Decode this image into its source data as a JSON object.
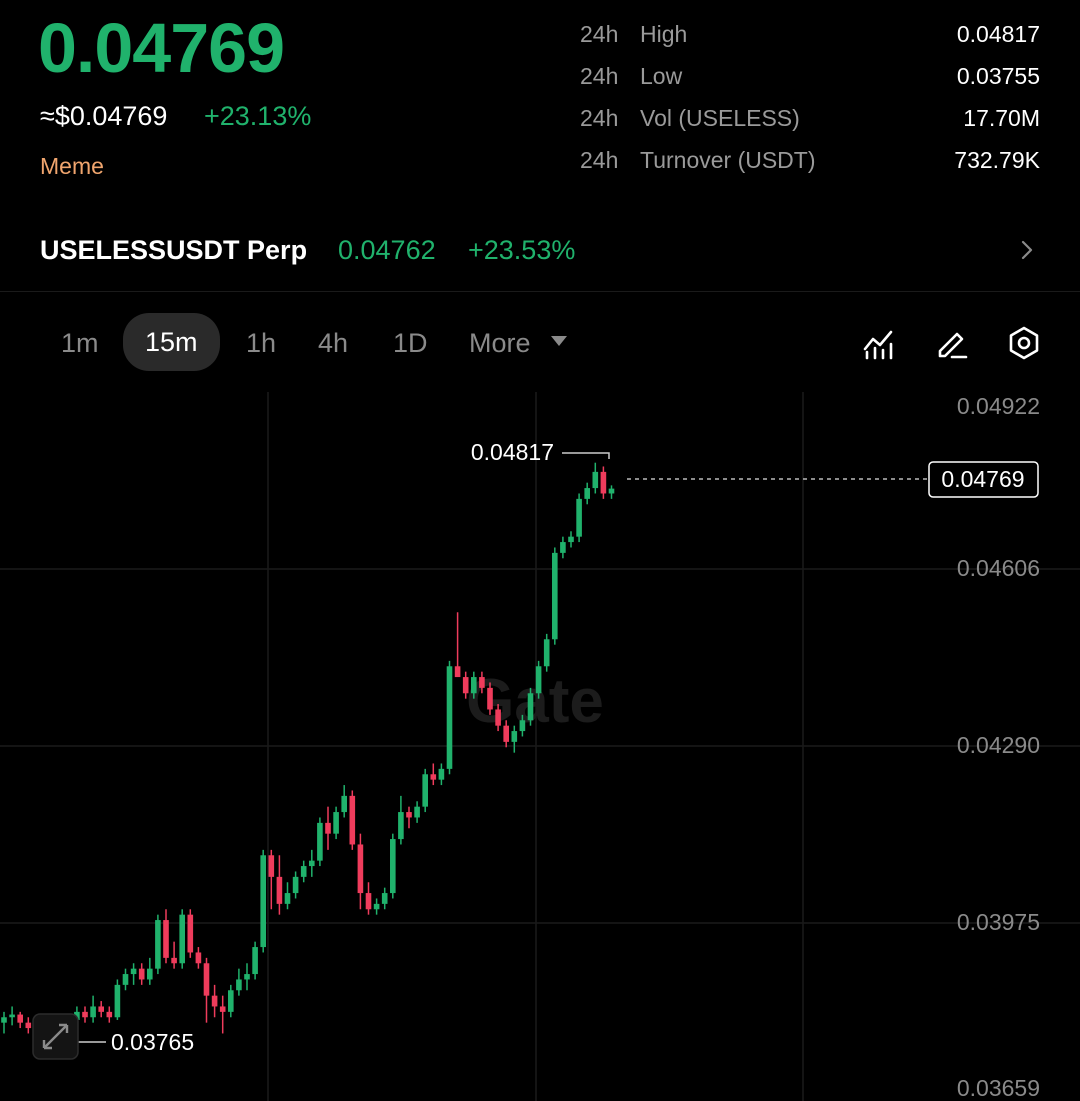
{
  "header": {
    "last_price": "0.04769",
    "usd_price": "≈$0.04769",
    "change_pct": "+23.13%",
    "tag": "Meme"
  },
  "stats": [
    {
      "period": "24h",
      "label": "High",
      "value": "0.04817"
    },
    {
      "period": "24h",
      "label": "Low",
      "value": "0.03755"
    },
    {
      "period": "24h",
      "label": "Vol (USELESS)",
      "value": "17.70M"
    },
    {
      "period": "24h",
      "label": "Turnover (USDT)",
      "value": "732.79K"
    }
  ],
  "perp": {
    "symbol": "USELESSUSDT Perp",
    "price": "0.04762",
    "change_pct": "+23.53%"
  },
  "timeframes": {
    "items": [
      "1m",
      "15m",
      "1h",
      "4h",
      "1D"
    ],
    "active": "15m",
    "more_label": "More"
  },
  "toolbar_icons": [
    "indicator-icon",
    "draw-icon",
    "settings-icon"
  ],
  "colors": {
    "up": "#20b26c",
    "down": "#ef3c5c",
    "accent_tag": "#f0a56e"
  },
  "chart_data": {
    "type": "candlestick",
    "y_ticks": [
      "0.04922",
      "0.04606",
      "0.04290",
      "0.03975",
      "0.03659"
    ],
    "ylim": [
      0.03659,
      0.04922
    ],
    "high_label": "0.04817",
    "low_label": "0.03765",
    "current_price_label": "0.04769",
    "watermark": "Gate",
    "candles": [
      [
        0.0378,
        0.038,
        0.0376,
        0.0379
      ],
      [
        0.0379,
        0.0381,
        0.03775,
        0.03795
      ],
      [
        0.03795,
        0.038,
        0.0377,
        0.0378
      ],
      [
        0.0378,
        0.0379,
        0.0376,
        0.0377
      ],
      [
        0.0377,
        0.0379,
        0.0376,
        0.03785
      ],
      [
        0.03785,
        0.0379,
        0.03765,
        0.03775
      ],
      [
        0.03775,
        0.03785,
        0.0376,
        0.0377
      ],
      [
        0.0377,
        0.0378,
        0.03755,
        0.03765
      ],
      [
        0.0377,
        0.0379,
        0.0376,
        0.03785
      ],
      [
        0.03785,
        0.0381,
        0.03775,
        0.038
      ],
      [
        0.038,
        0.0381,
        0.0378,
        0.0379
      ],
      [
        0.0379,
        0.0383,
        0.0378,
        0.0381
      ],
      [
        0.0381,
        0.0382,
        0.0379,
        0.038
      ],
      [
        0.038,
        0.0381,
        0.0378,
        0.0379
      ],
      [
        0.0379,
        0.0386,
        0.03785,
        0.0385
      ],
      [
        0.0385,
        0.0388,
        0.0384,
        0.0387
      ],
      [
        0.0387,
        0.0389,
        0.0385,
        0.0388
      ],
      [
        0.0388,
        0.0389,
        0.0385,
        0.0386
      ],
      [
        0.0386,
        0.039,
        0.0385,
        0.0388
      ],
      [
        0.0388,
        0.0398,
        0.0387,
        0.0397
      ],
      [
        0.0397,
        0.0399,
        0.0389,
        0.039
      ],
      [
        0.039,
        0.0393,
        0.0388,
        0.0389
      ],
      [
        0.0389,
        0.0399,
        0.0388,
        0.0398
      ],
      [
        0.0398,
        0.0399,
        0.039,
        0.0391
      ],
      [
        0.0391,
        0.0392,
        0.0388,
        0.0389
      ],
      [
        0.0389,
        0.039,
        0.0378,
        0.0383
      ],
      [
        0.0383,
        0.0385,
        0.0379,
        0.0381
      ],
      [
        0.0381,
        0.0383,
        0.0376,
        0.038
      ],
      [
        0.038,
        0.0385,
        0.0379,
        0.0384
      ],
      [
        0.0384,
        0.0388,
        0.0383,
        0.0386
      ],
      [
        0.0386,
        0.0389,
        0.0384,
        0.0387
      ],
      [
        0.0387,
        0.0393,
        0.0386,
        0.0392
      ],
      [
        0.0392,
        0.041,
        0.0391,
        0.0409
      ],
      [
        0.0409,
        0.041,
        0.0399,
        0.0405
      ],
      [
        0.0405,
        0.0409,
        0.0398,
        0.04
      ],
      [
        0.04,
        0.0404,
        0.0399,
        0.0402
      ],
      [
        0.0402,
        0.0406,
        0.0401,
        0.0405
      ],
      [
        0.0405,
        0.0408,
        0.0404,
        0.0407
      ],
      [
        0.0407,
        0.041,
        0.0405,
        0.0408
      ],
      [
        0.0408,
        0.0416,
        0.0407,
        0.0415
      ],
      [
        0.0415,
        0.0418,
        0.041,
        0.0413
      ],
      [
        0.0413,
        0.0418,
        0.0412,
        0.0417
      ],
      [
        0.0417,
        0.0422,
        0.0416,
        0.042
      ],
      [
        0.042,
        0.0421,
        0.041,
        0.0411
      ],
      [
        0.0411,
        0.0413,
        0.0399,
        0.0402
      ],
      [
        0.0402,
        0.0404,
        0.0398,
        0.0399
      ],
      [
        0.0399,
        0.0401,
        0.0398,
        0.04
      ],
      [
        0.04,
        0.0403,
        0.0399,
        0.0402
      ],
      [
        0.0402,
        0.0413,
        0.0401,
        0.0412
      ],
      [
        0.0412,
        0.042,
        0.0411,
        0.0417
      ],
      [
        0.0417,
        0.0418,
        0.0414,
        0.0416
      ],
      [
        0.0416,
        0.0419,
        0.0415,
        0.0418
      ],
      [
        0.0418,
        0.0425,
        0.0417,
        0.0424
      ],
      [
        0.0424,
        0.0426,
        0.0422,
        0.0423
      ],
      [
        0.0423,
        0.0426,
        0.0422,
        0.0425
      ],
      [
        0.0425,
        0.0445,
        0.0424,
        0.0444
      ],
      [
        0.0444,
        0.0454,
        0.0443,
        0.0442
      ],
      [
        0.0442,
        0.0443,
        0.0438,
        0.0439
      ],
      [
        0.0439,
        0.0443,
        0.0438,
        0.0442
      ],
      [
        0.0442,
        0.0443,
        0.0439,
        0.044
      ],
      [
        0.044,
        0.0441,
        0.0435,
        0.0436
      ],
      [
        0.0436,
        0.0437,
        0.0432,
        0.0433
      ],
      [
        0.0433,
        0.0434,
        0.0429,
        0.043
      ],
      [
        0.043,
        0.0433,
        0.0428,
        0.0432
      ],
      [
        0.0432,
        0.0435,
        0.0431,
        0.0434
      ],
      [
        0.0434,
        0.044,
        0.0433,
        0.0439
      ],
      [
        0.0439,
        0.0445,
        0.0438,
        0.0444
      ],
      [
        0.0444,
        0.045,
        0.0443,
        0.0449
      ],
      [
        0.0449,
        0.0466,
        0.0448,
        0.0465
      ],
      [
        0.0465,
        0.0468,
        0.0464,
        0.0467
      ],
      [
        0.0467,
        0.0469,
        0.0466,
        0.0468
      ],
      [
        0.0468,
        0.0476,
        0.0467,
        0.0475
      ],
      [
        0.0475,
        0.0478,
        0.0474,
        0.0477
      ],
      [
        0.0477,
        0.04817,
        0.0476,
        0.048
      ],
      [
        0.048,
        0.0481,
        0.0475,
        0.0476
      ],
      [
        0.0476,
        0.04775,
        0.0475,
        0.04769
      ]
    ]
  }
}
